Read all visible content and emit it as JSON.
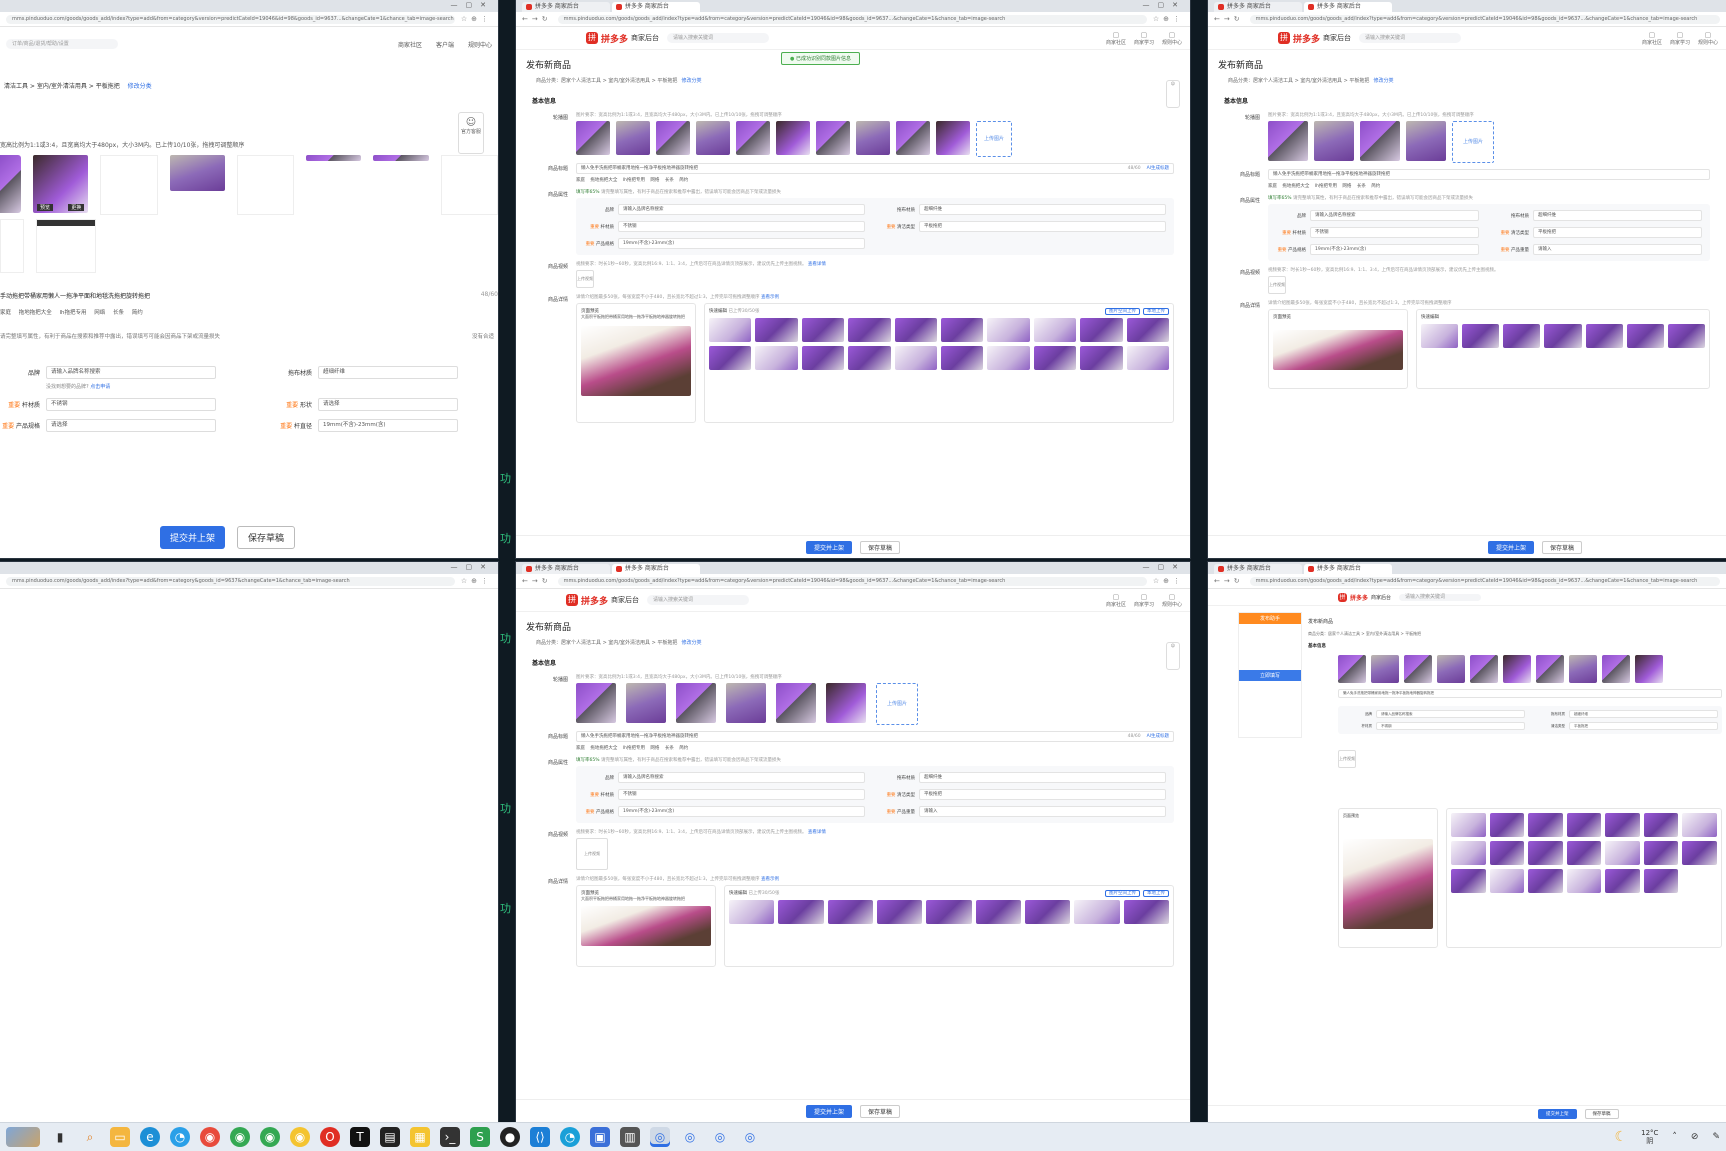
{
  "common": {
    "brand": "拼多多",
    "brand_sub": "商家后台",
    "page_title": "发布新商品",
    "section_basic": "基本信息",
    "submit": "提交并上架",
    "save_draft": "保存草稿",
    "tab_title": "拼多多 商家后台",
    "url": "mms.pinduoduo.com/goods/goods_add/index?type=add&from=category&version=predictCateId=19046&id=98&goods_id=9637...&changeCate=1&chance_tab=image-search",
    "search_placeholder": "请输入搜索关键词",
    "header_links": [
      "商家社区",
      "商家学习",
      "规则中心"
    ],
    "category_crumb": "商品分类：居家个人清洁工具 > 室内/室外清洁用具 > 平板拖把",
    "edit_category": "修改分类",
    "labels": {
      "images": "轮播图",
      "title": "商品标题",
      "attrs": "商品属性",
      "video": "商品视频",
      "detail": "商品详情"
    },
    "image_hint": "图片要求：宽高比例为1:1或3:4，且宽高均大于480px，大小3M内。已上传10/10张，拖拽可调整顺序",
    "upload_label": "上传图片",
    "product_title": "懒人免手洗拖把带桶家用地拖一拖净平板拖地神器旋转拖把",
    "title_counter": "48/60",
    "ai_btn": "AI生成标题",
    "title_tags": "家庭  拖地拖把大全  lh拖把专用  网络  长条  简约",
    "attr_hint": "请完整填写属性，有利于商品在搜索和推荐中露出，错误填写可能会因商品下架或流量损失",
    "attr_score": "填写率65%",
    "attrs": [
      {
        "label": "品牌",
        "value": "请输入品牌名称搜索"
      },
      {
        "label": "拖布材质",
        "value": "超细纤维"
      },
      {
        "label": "杆材质",
        "value": "不锈钢",
        "req": true
      },
      {
        "label": "清洁类型",
        "value": "平板拖把",
        "req": true
      },
      {
        "label": "产品规格",
        "value": "19mm(不含)-23mm(含)",
        "req": true
      },
      {
        "label": "产品重量",
        "value": "请输入",
        "req": true
      }
    ],
    "brand_help": "没找到想要的品牌?",
    "brand_apply": "点击申请",
    "video_hint": "视频要求：时长1秒~60秒，宽高比例16:9、1:1、3:4，上传后可在商品详情页顶部展示，建议优先上传主图视频。",
    "video_link": "查看详情",
    "video_upload": "上传视频",
    "detail_hint": "详情介绍图最多50张，每张宽度不小于480，且长宽比不超过1:3，上传完毕可拖拽调整顺序",
    "detail_link": "查看示例",
    "detail_preview_title": "页面预览",
    "detail_preview_text": "大面积平板拖把带桶家用地拖一拖净平板拖地神器旋转拖把",
    "gallery_title": "快速编辑",
    "gallery_sub": "已上传30/50张",
    "gallery_btn1": "图片空间上传",
    "gallery_btn2": "本地上传",
    "toast": "已成功识别同款图片信息"
  },
  "window1": {
    "url": "mms.pinduoduo.com/goods/goods_add/index?type=add&from=category&version=predictCateId=19046&id=98&goods_id=9637...&changeCate=1&chance_tab=image-search",
    "search_placeholder": "订单/商品/退货/帮助/设置",
    "crumb": "清洁工具 > 室内/室外清洁用具 > 平板拖把",
    "edit": "修改分类",
    "hint": "宽高比例为1:1或3:4，且宽高均大于480px，大小3M内。已上传10/10张，拖拽可调整顺序",
    "badge1": "预览",
    "badge2": "更换",
    "title": "手动拖把带桶家用懒人一拖净平面和地毯洗拖把旋转拖把",
    "counter": "48/60",
    "tags": "家庭  拖地拖把大全  lh拖把专用  网络  长条  简约",
    "attr_hint": "请完整填写属性，有利于商品在搜索和推荐中露出，错误填写可能会因商品下架或流量损失",
    "attr_right": "没有合适",
    "rows": [
      {
        "label": "品牌",
        "value": "请输入品牌名称搜索",
        "label2": "拖布材质",
        "value2": "超细纤维"
      },
      {
        "label": "杆材质",
        "value": "不锈钢",
        "label2": "形状",
        "value2": "请选择",
        "req": true
      },
      {
        "label": "产品规格",
        "value": "请选择",
        "label2": "杆直径",
        "value2": "19mm(不含)-23mm(含)",
        "req": true
      }
    ],
    "brand_help": "没找到想要的品牌?",
    "brand_apply": "点击申请",
    "side_badge": "官方客服",
    "header_links": [
      "商家社区",
      "客户端",
      "规则中心"
    ]
  },
  "window4": {
    "url": "mms.pinduoduo.com/goods/goods_add/index?type=add&from=category&goods_id=9637&changeCate=1&chance_tab=image-search"
  },
  "window6": {
    "panel_title": "发布助手",
    "panel_btn": "立即填写"
  },
  "taskbar": {
    "temp": "12°C",
    "weather": "阴"
  },
  "colors": {
    "brand": "#e02e24",
    "primary": "#2f6fe4",
    "purple": "#9b59d9",
    "terminal": "#2ec27e"
  }
}
